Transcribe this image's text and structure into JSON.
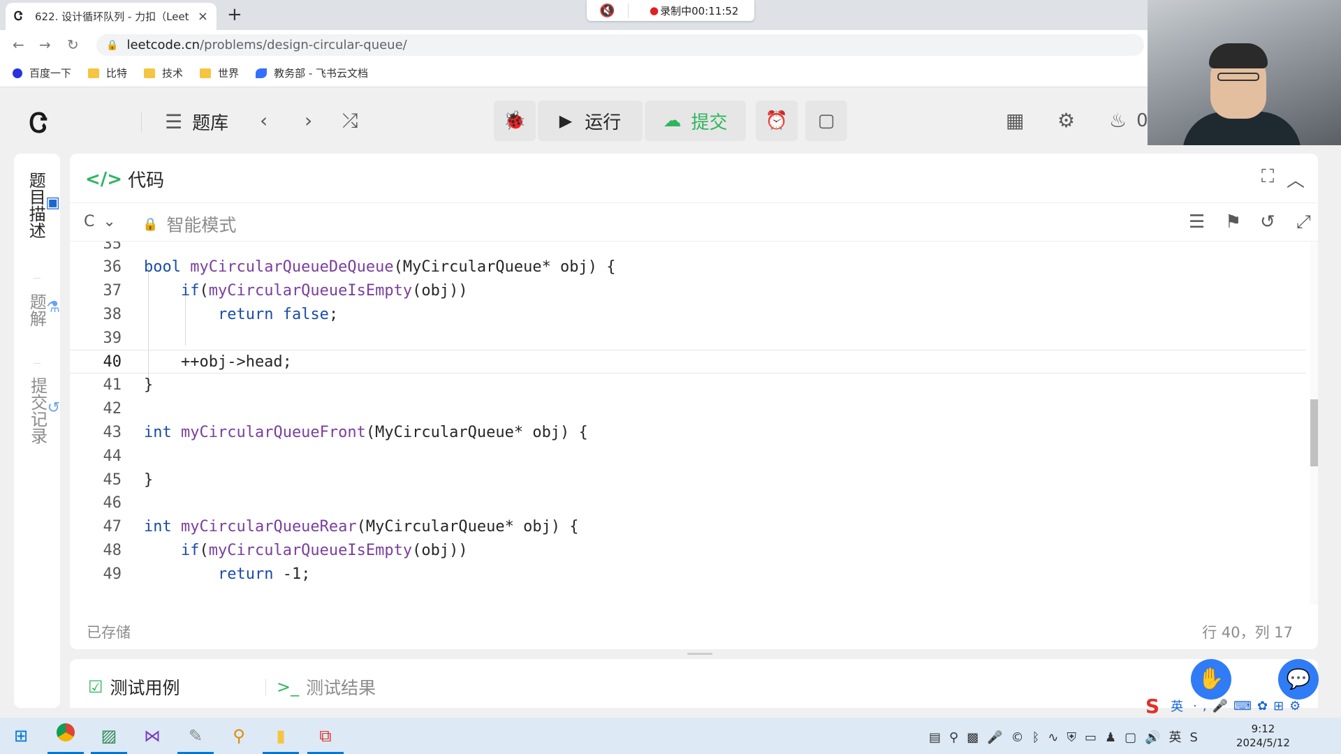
{
  "browser": {
    "tab_title": "622. 设计循环队列 - 力扣（Leet",
    "tab_close": "×",
    "new_tab": "+",
    "url_host": "leetcode.cn",
    "url_path": "/problems/design-circular-queue/",
    "recording": "录制中00:11:52"
  },
  "bookmarks": [
    {
      "label": "百度一下",
      "icon": "paw-icon"
    },
    {
      "label": "比特",
      "icon": "folder-icon"
    },
    {
      "label": "技术",
      "icon": "folder-icon"
    },
    {
      "label": "世界",
      "icon": "folder-icon"
    },
    {
      "label": "教务部 - 飞书云文档",
      "icon": "feishu-icon"
    }
  ],
  "header": {
    "problem_list": "题库",
    "run": "运行",
    "submit": "提交",
    "streak": "0"
  },
  "sidebar": {
    "tabs": [
      {
        "label": "题目描述"
      },
      {
        "label": "题解"
      },
      {
        "label": "提交记录"
      }
    ]
  },
  "editor": {
    "title": "代码",
    "language": "C",
    "mode": "智能模式",
    "saved": "已存储",
    "cursor_pos": "行 40，列 17",
    "lines": [
      {
        "num": "35",
        "text": ""
      },
      {
        "num": "36",
        "text": "bool myCircularQueueDeQueue(MyCircularQueue* obj) {"
      },
      {
        "num": "37",
        "text": "    if(myCircularQueueIsEmpty(obj))"
      },
      {
        "num": "38",
        "text": "        return false;"
      },
      {
        "num": "39",
        "text": ""
      },
      {
        "num": "40",
        "text": "    ++obj->head;"
      },
      {
        "num": "41",
        "text": "}"
      },
      {
        "num": "42",
        "text": ""
      },
      {
        "num": "43",
        "text": "int myCircularQueueFront(MyCircularQueue* obj) {"
      },
      {
        "num": "44",
        "text": ""
      },
      {
        "num": "45",
        "text": "}"
      },
      {
        "num": "46",
        "text": ""
      },
      {
        "num": "47",
        "text": "int myCircularQueueRear(MyCircularQueue* obj) {"
      },
      {
        "num": "48",
        "text": "    if(myCircularQueueIsEmpty(obj))"
      },
      {
        "num": "49",
        "text": "        return -1;"
      }
    ]
  },
  "testpanel": {
    "cases": "测试用例",
    "results": "测试结果"
  },
  "ime": {
    "lang": "英"
  },
  "taskbar": {
    "time": "9:12",
    "date": "2024/5/12"
  }
}
